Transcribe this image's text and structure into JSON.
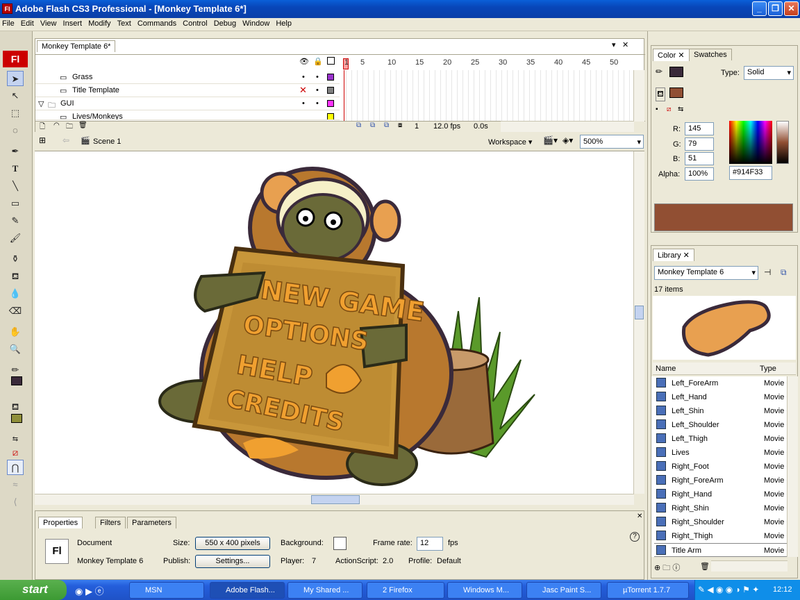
{
  "window": {
    "title": "Adobe Flash CS3 Professional - [Monkey Template 6*]",
    "app_icon": "Fl"
  },
  "menu": [
    "File",
    "Edit",
    "View",
    "Insert",
    "Modify",
    "Text",
    "Commands",
    "Control",
    "Debug",
    "Window",
    "Help"
  ],
  "timeline": {
    "doc_tab": "Monkey Template 6*",
    "layers": [
      {
        "name": "Grass",
        "color": "#9933cc"
      },
      {
        "name": "Title Template",
        "color": "#808080"
      },
      {
        "name": "GUI",
        "color": "#ff33ff"
      },
      {
        "name": "Lives/Monkeys",
        "color": "#ffff00"
      }
    ],
    "frame_numbers": [
      "1",
      "5",
      "10",
      "15",
      "20",
      "25",
      "30",
      "35",
      "40",
      "45",
      "50"
    ],
    "current_frame": "1",
    "fps": "12.0 fps",
    "time": "0.0s"
  },
  "stagebar": {
    "scene": "Scene 1",
    "workspace": "Workspace",
    "zoom": "500%"
  },
  "stage": {
    "sign_lines": [
      "NEW GAME",
      "OPTIONS",
      "HELP",
      "CREDITS"
    ]
  },
  "properties": {
    "tabs": [
      "Properties",
      "Filters",
      "Parameters"
    ],
    "doc_label": "Document",
    "doc_name": "Monkey Template 6",
    "size_label": "Size:",
    "size_value": "550 x 400 pixels",
    "background_label": "Background:",
    "frame_rate_label": "Frame rate:",
    "frame_rate": "12",
    "fps_unit": "fps",
    "publish_label": "Publish:",
    "settings_button": "Settings...",
    "player_label": "Player:",
    "player_value": "7",
    "actionscript_label": "ActionScript:",
    "actionscript_value": "2.0",
    "profile_label": "Profile:",
    "profile_value": "Default"
  },
  "color_panel": {
    "tabs": [
      "Color",
      "Swatches"
    ],
    "type_label": "Type:",
    "type_value": "Solid",
    "r_label": "R:",
    "r": "145",
    "g_label": "G:",
    "g": "79",
    "b_label": "B:",
    "b": "51",
    "alpha_label": "Alpha:",
    "alpha": "100%",
    "hex": "#914F33",
    "color": "#914f33"
  },
  "library": {
    "tab": "Library",
    "document": "Monkey Template 6",
    "count": "17 items",
    "col_name": "Name",
    "col_type": "Type",
    "items": [
      {
        "name": "Left_ForeArm",
        "type": "Movie C"
      },
      {
        "name": "Left_Hand",
        "type": "Movie C"
      },
      {
        "name": "Left_Shin",
        "type": "Movie C"
      },
      {
        "name": "Left_Shoulder",
        "type": "Movie C"
      },
      {
        "name": "Left_Thigh",
        "type": "Movie C"
      },
      {
        "name": "Lives",
        "type": "Movie C"
      },
      {
        "name": "Right_Foot",
        "type": "Movie C"
      },
      {
        "name": "Right_ForeArm",
        "type": "Movie C"
      },
      {
        "name": "Right_Hand",
        "type": "Movie C"
      },
      {
        "name": "Right_Shin",
        "type": "Movie C"
      },
      {
        "name": "Right_Shoulder",
        "type": "Movie C"
      },
      {
        "name": "Right_Thigh",
        "type": "Movie C"
      },
      {
        "name": "Title Arm",
        "type": "Movie C"
      }
    ]
  },
  "taskbar": {
    "start": "start",
    "tasks": [
      "MSN",
      "Adobe Flash...",
      "My Shared ...",
      "2 Firefox",
      "Windows M...",
      "Jasc Paint S...",
      "µTorrent 1.7.7"
    ],
    "clock": "12:12"
  }
}
